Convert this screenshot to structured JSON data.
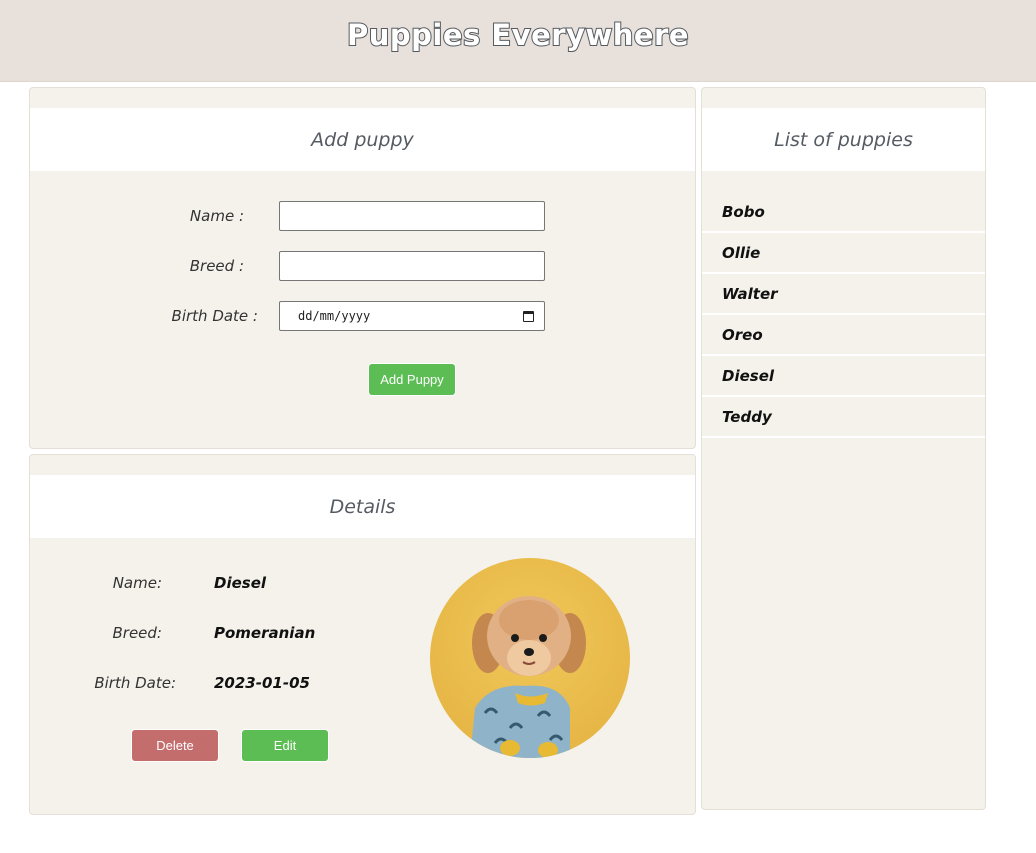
{
  "header": {
    "title": "Puppies Everywhere"
  },
  "add_puppy": {
    "title": "Add puppy",
    "name_label": "Name :",
    "breed_label": "Breed :",
    "birth_date_label": "Birth Date :",
    "name_value": "",
    "breed_value": "",
    "birth_date_placeholder": "dd/mm/yyyy",
    "submit_label": "Add Puppy"
  },
  "details": {
    "title": "Details",
    "name_label": "Name:",
    "breed_label": "Breed:",
    "birth_date_label": "Birth Date:",
    "name": "Diesel",
    "breed": "Pomeranian",
    "birth_date": "2023-01-05",
    "delete_label": "Delete",
    "edit_label": "Edit",
    "photo_icon": "dog-photo"
  },
  "puppy_list": {
    "title": "List of puppies",
    "items": [
      "Bobo",
      "Ollie",
      "Walter",
      "Oreo",
      "Diesel",
      "Teddy"
    ]
  },
  "colors": {
    "header_bg": "#e8e0db",
    "card_bg": "#f5f2eb",
    "green_button": "#5cbd54",
    "red_button": "#c46d6d"
  }
}
